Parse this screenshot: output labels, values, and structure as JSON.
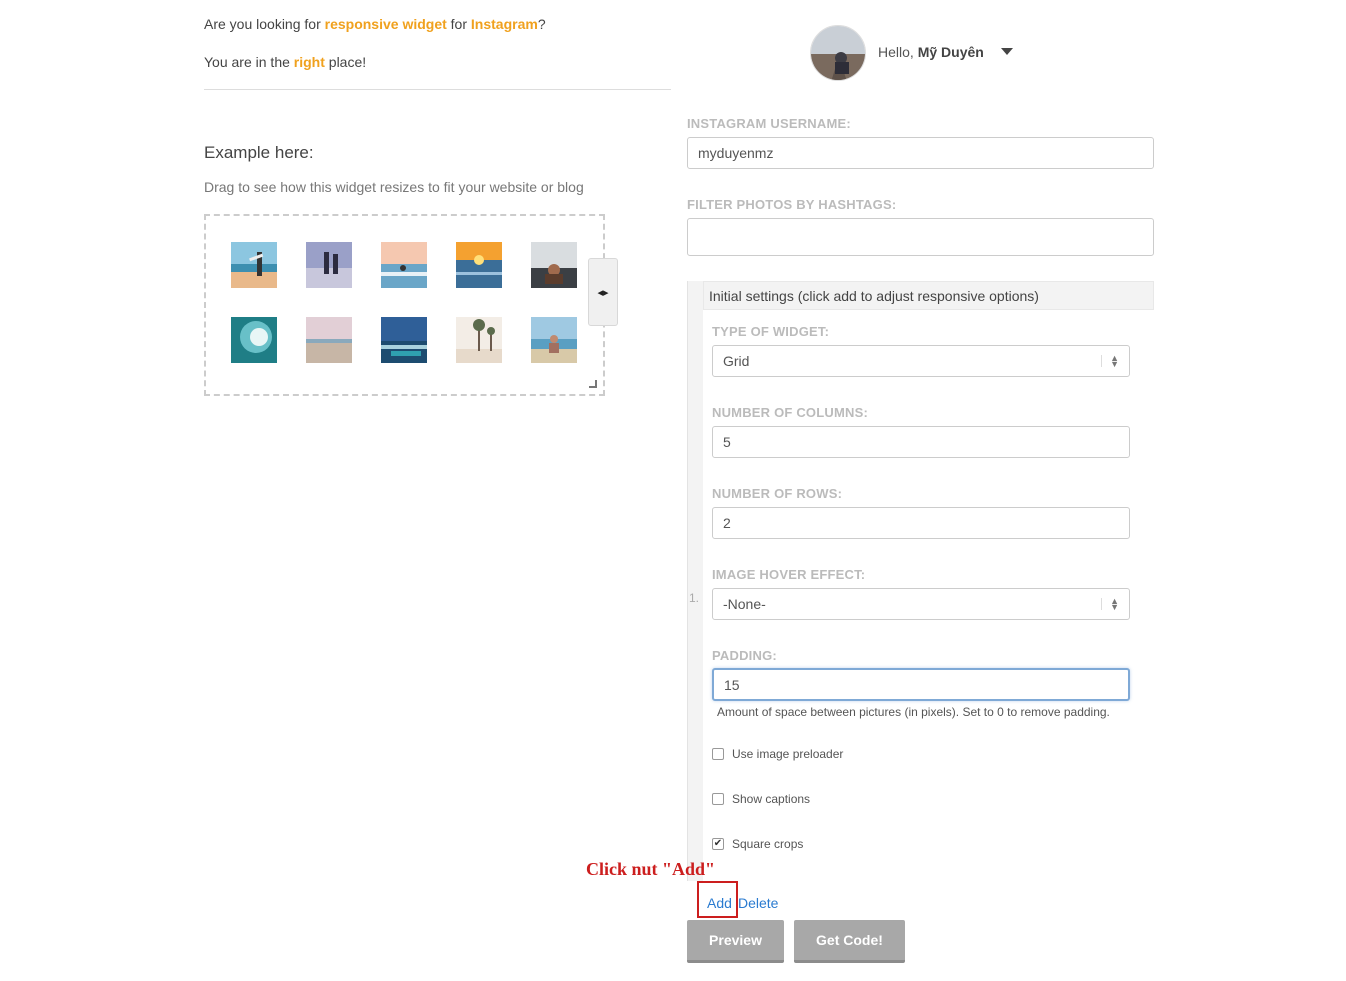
{
  "intro": {
    "line1_a": "Are you looking for ",
    "line1_hl1": "responsive widget",
    "line1_b": " for ",
    "line1_hl2": "Instagram",
    "line1_c": "?",
    "line2_a": "You are in the ",
    "line2_hl": "right",
    "line2_b": " place!"
  },
  "example": {
    "title": "Example here:",
    "subtitle": "Drag to see how this widget resizes to fit your website or blog",
    "handle_icon": "◂▸"
  },
  "user": {
    "greeting": "Hello,",
    "name": "Mỹ Duyên"
  },
  "form": {
    "username_label": "INSTAGRAM USERNAME:",
    "username_value": "myduyenmz",
    "hashtags_label": "FILTER PHOTOS BY HASHTAGS:",
    "hashtags_value": ""
  },
  "settings": {
    "header": "Initial settings (click add to adjust responsive options)",
    "row_number": "1.",
    "type_label": "TYPE OF WIDGET:",
    "type_value": "Grid",
    "columns_label": "NUMBER OF COLUMNS:",
    "columns_value": "5",
    "rows_label": "NUMBER OF ROWS:",
    "rows_value": "2",
    "hover_label": "IMAGE HOVER EFFECT:",
    "hover_value": "-None-",
    "padding_label": "PADDING:",
    "padding_value": "15",
    "padding_help": "Amount of space between pictures (in pixels). Set to 0 to remove padding.",
    "preloader_label": "Use image preloader",
    "preloader_checked": false,
    "captions_label": "Show captions",
    "captions_checked": false,
    "square_label": "Square crops",
    "square_checked": true
  },
  "annotation": {
    "text": "Click nut \"Add\""
  },
  "actions": {
    "add": "Add",
    "delete": "Delete",
    "preview": "Preview",
    "get_code": "Get Code!"
  }
}
